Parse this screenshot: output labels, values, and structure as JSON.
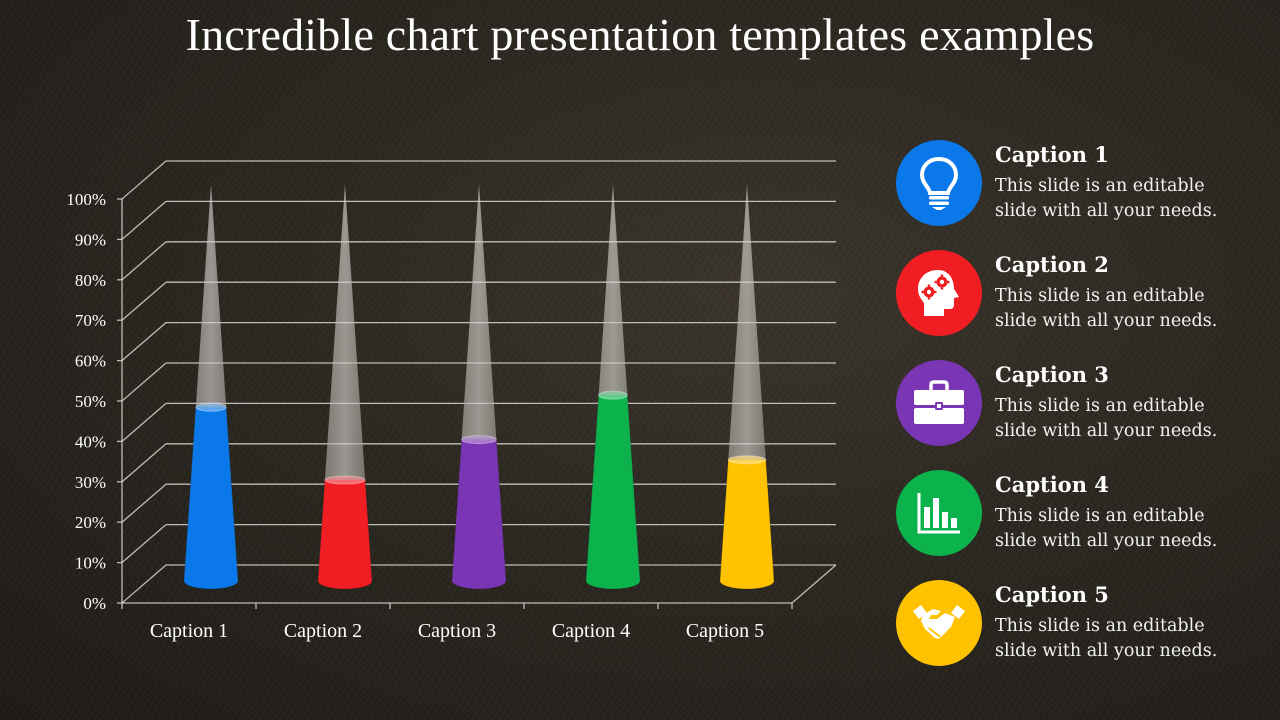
{
  "title": "Incredible chart presentation templates examples",
  "chart_data": {
    "type": "bar",
    "style": "3d-cone",
    "title": "",
    "xlabel": "",
    "ylabel": "",
    "categories": [
      "Caption  1",
      "Caption  2",
      "Caption  3",
      "Caption  4",
      "Caption  5"
    ],
    "values": [
      43,
      25,
      35,
      46,
      30
    ],
    "max_value": 100,
    "units": "%",
    "ylim": [
      0,
      100
    ],
    "yticks": [
      "0%",
      "10%",
      "20%",
      "30%",
      "40%",
      "50%",
      "60%",
      "70%",
      "80%",
      "90%",
      "100%"
    ],
    "grid": true,
    "legend": "none",
    "colors": [
      "#0a78e8",
      "#f01e23",
      "#7a35b5",
      "#0cb34d",
      "#ffc200"
    ]
  },
  "legend": {
    "items": [
      {
        "title": "Caption 1",
        "desc_line1": "This slide is an editable",
        "desc_line2": "slide with all your needs.",
        "color": "#0a78e8",
        "icon": "lightbulb-icon"
      },
      {
        "title": "Caption 2",
        "desc_line1": "This slide is an editable",
        "desc_line2": "slide with all your needs.",
        "color": "#f01e23",
        "icon": "head-gears-icon"
      },
      {
        "title": "Caption 3",
        "desc_line1": "This slide is an editable",
        "desc_line2": "slide with all your needs.",
        "color": "#7a35b5",
        "icon": "briefcase-icon"
      },
      {
        "title": "Caption 4",
        "desc_line1": "This slide is an editable",
        "desc_line2": "slide with all your needs.",
        "color": "#0cb34d",
        "icon": "bar-chart-icon"
      },
      {
        "title": "Caption 5",
        "desc_line1": "This slide is an editable",
        "desc_line2": "slide with all your needs.",
        "color": "#ffc200",
        "icon": "handshake-icon"
      }
    ]
  }
}
